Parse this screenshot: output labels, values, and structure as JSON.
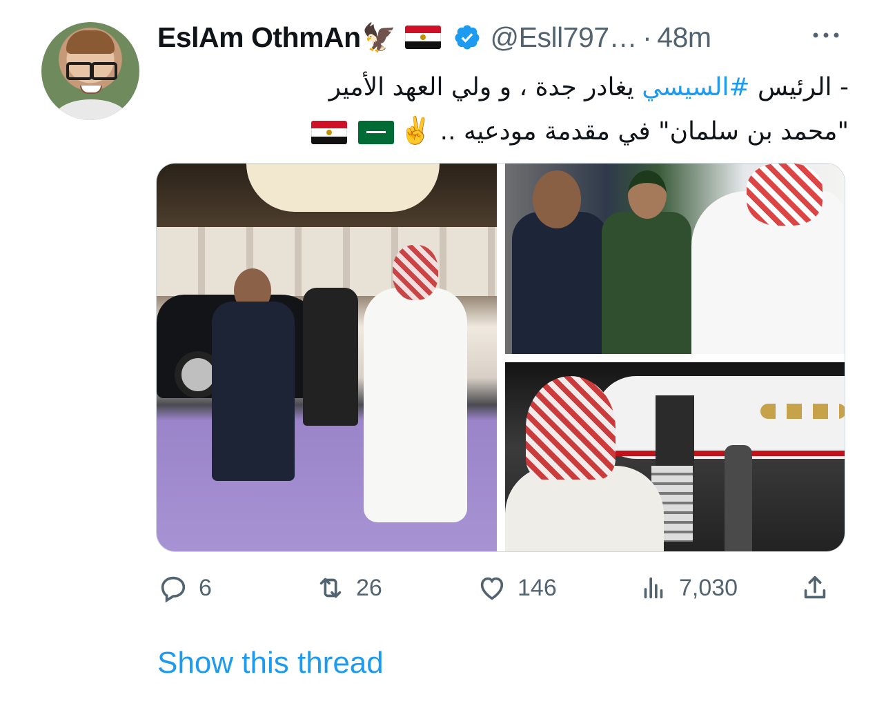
{
  "tweet": {
    "author": {
      "display_name": "EslAm OthmAn",
      "name_emojis": [
        "eagle",
        "egypt-flag"
      ],
      "verified": true,
      "handle": "@Esll797…",
      "separator": "·",
      "time": "48m"
    },
    "text": {
      "line1_prefix": "- الرئيس ",
      "hashtag": "#السيسي",
      "line1_suffix": "  يغادر جدة ، و ولي العهد الأمير",
      "line2": "\"محمد بن سلمان\" في مقدمة مودعيه .. ",
      "line2_emojis": [
        "victory-hand",
        "saudi-flag",
        "egypt-flag"
      ],
      "emoji_victory": "✌️"
    },
    "media": {
      "images": [
        {
          "name": "walking-photo"
        },
        {
          "name": "handshake-photo"
        },
        {
          "name": "airplane-photo"
        }
      ]
    },
    "actions": {
      "reply_count": "6",
      "retweet_count": "26",
      "like_count": "146",
      "views_count": "7,030"
    },
    "show_thread": "Show this thread"
  },
  "colors": {
    "text_primary": "#0f1419",
    "text_secondary": "#536471",
    "link": "#1d9bf0",
    "verified_badge": "#1d9bf0"
  }
}
